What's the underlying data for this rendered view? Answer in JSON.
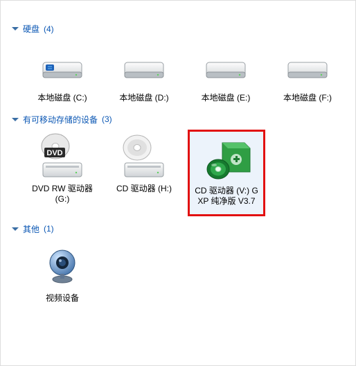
{
  "groups": [
    {
      "title": "硬盘",
      "count": "(4)",
      "items": [
        {
          "label": "本地磁盘 (C:)",
          "icon": "hdd-win",
          "name": "drive-c"
        },
        {
          "label": "本地磁盘 (D:)",
          "icon": "hdd",
          "name": "drive-d"
        },
        {
          "label": "本地磁盘 (E:)",
          "icon": "hdd",
          "name": "drive-e"
        },
        {
          "label": "本地磁盘 (F:)",
          "icon": "hdd",
          "name": "drive-f"
        }
      ]
    },
    {
      "title": "有可移动存储的设备",
      "count": "(3)",
      "items": [
        {
          "label": "DVD RW 驱动器 (G:)",
          "icon": "dvd-rw",
          "name": "drive-g"
        },
        {
          "label": "CD 驱动器 (H:)",
          "icon": "cd",
          "name": "drive-h"
        },
        {
          "label": "CD 驱动器 (V:) GXP 纯净版 V3.7",
          "icon": "cd-green",
          "name": "drive-v",
          "highlight": true,
          "selected": true
        }
      ]
    },
    {
      "title": "其他",
      "count": "(1)",
      "items": [
        {
          "label": "视频设备",
          "icon": "webcam",
          "name": "video-device"
        }
      ]
    }
  ]
}
